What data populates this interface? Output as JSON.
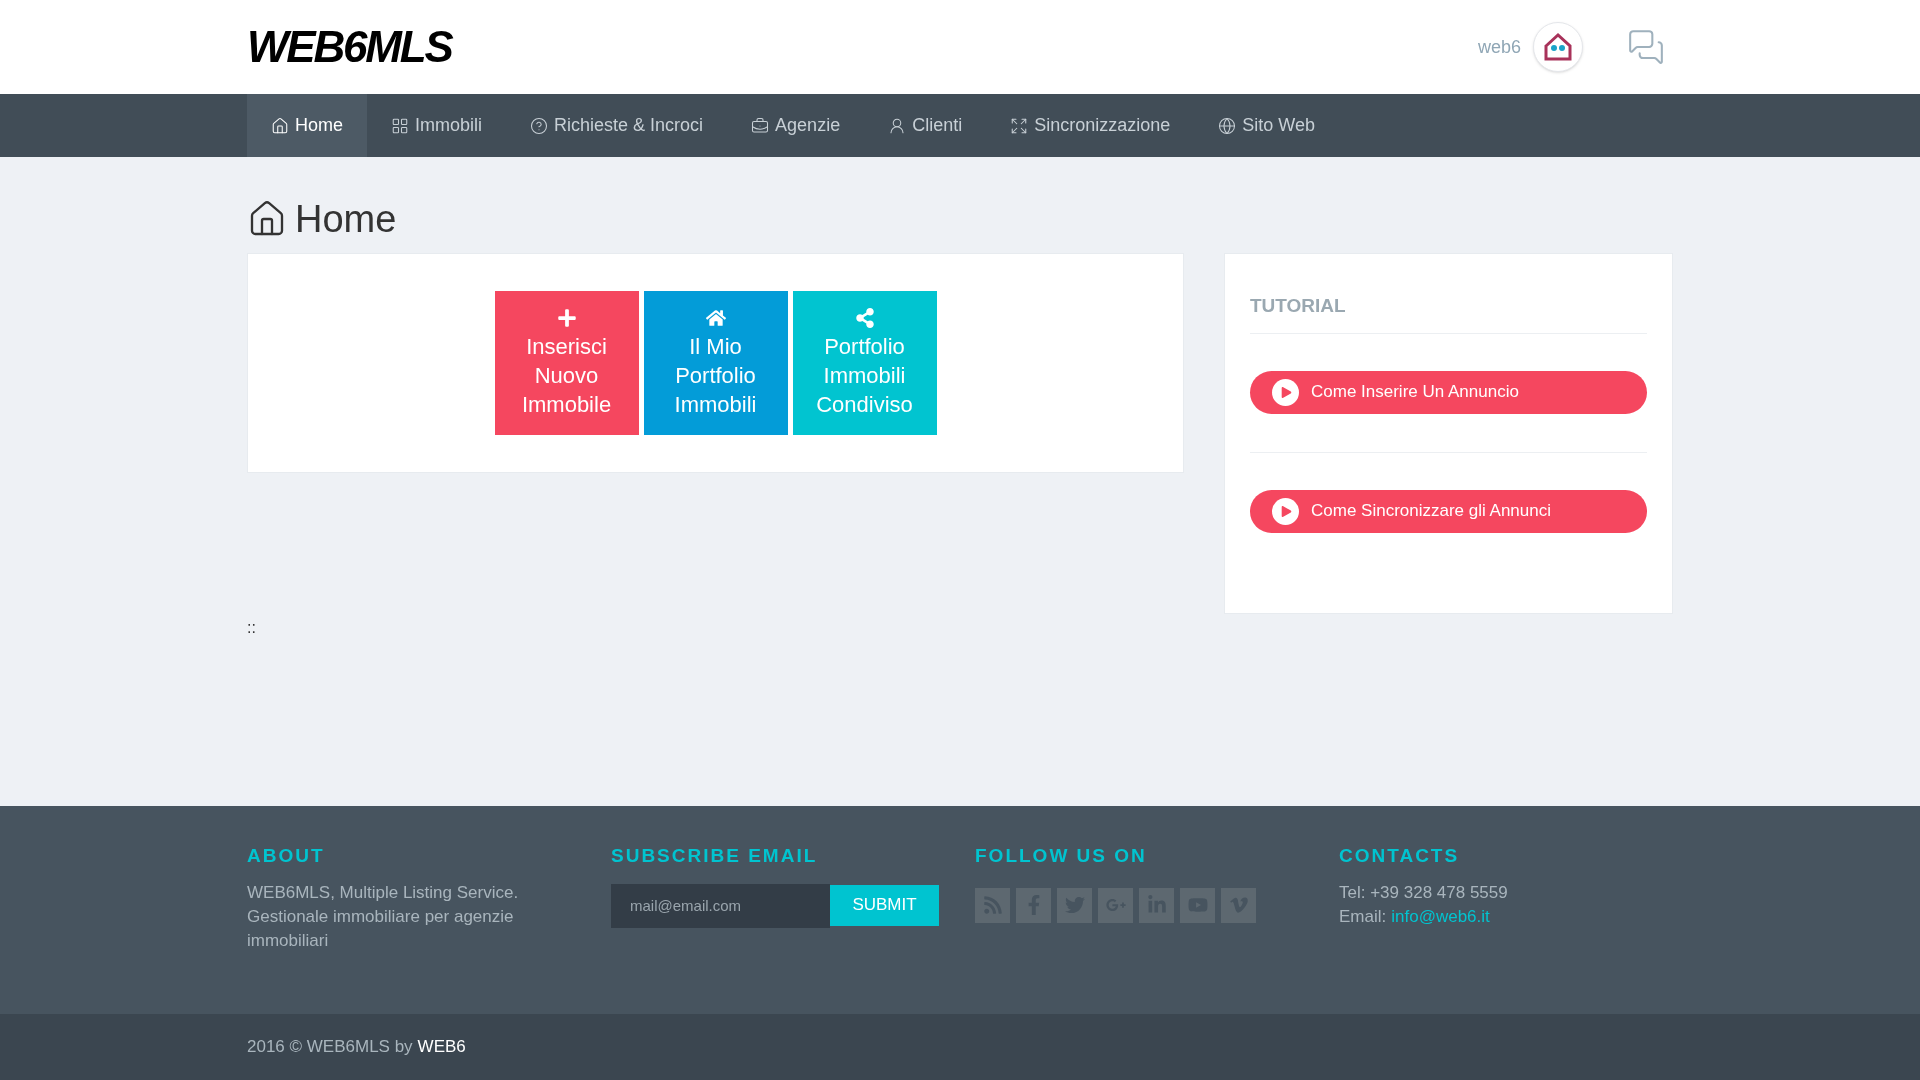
{
  "header": {
    "logo": "WEB6MLS",
    "user_name": "web6"
  },
  "nav": [
    {
      "label": "Home",
      "kind": "home",
      "selected": true
    },
    {
      "label": "Immobili",
      "kind": "grid",
      "selected": false
    },
    {
      "label": "Richieste & Incroci",
      "kind": "help",
      "selected": false
    },
    {
      "label": "Agenzie",
      "kind": "briefcase",
      "selected": false
    },
    {
      "label": "Clienti",
      "kind": "user",
      "selected": false
    },
    {
      "label": "Sincronizzazione",
      "kind": "expand",
      "selected": false
    },
    {
      "label": "Sito Web",
      "kind": "globe",
      "selected": false
    }
  ],
  "page_title": "Home",
  "actions": [
    {
      "label": "Inserisci Nuovo Immobile",
      "kind": "add",
      "color": "#f5475f"
    },
    {
      "label": "Il Mio Portfolio Immobili",
      "kind": "portfolio",
      "color": "#039cd8"
    },
    {
      "label": "Portfolio Immobili Condiviso",
      "kind": "shared",
      "color": "#01c4d0"
    }
  ],
  "separator": "::",
  "tutorial": {
    "title": "TUTORIAL",
    "items": [
      "Come Inserire Un Annuncio",
      "Come Sincronizzare gli Annunci"
    ]
  },
  "footer": {
    "about": {
      "title": "ABOUT",
      "text": "WEB6MLS, Multiple Listing Service. Gestionale immobiliare per agenzie immobiliari"
    },
    "subscribe": {
      "title": "SUBSCRIBE EMAIL",
      "placeholder": "mail@email.com",
      "button": "SUBMIT"
    },
    "follow": {
      "title": "FOLLOW US ON",
      "networks": [
        {
          "kind": "rss"
        },
        {
          "kind": "facebook"
        },
        {
          "kind": "twitter"
        },
        {
          "kind": "googleplus"
        },
        {
          "kind": "linkedin"
        },
        {
          "kind": "youtube"
        },
        {
          "kind": "vimeo"
        }
      ]
    },
    "contacts": {
      "title": "CONTACTS",
      "phone": "Tel: +39 328 478 5559",
      "email_label": "Email:",
      "email": "info@web6.it"
    }
  },
  "copyright": {
    "text": "2016 © WEB6MLS by",
    "link": "WEB6"
  }
}
